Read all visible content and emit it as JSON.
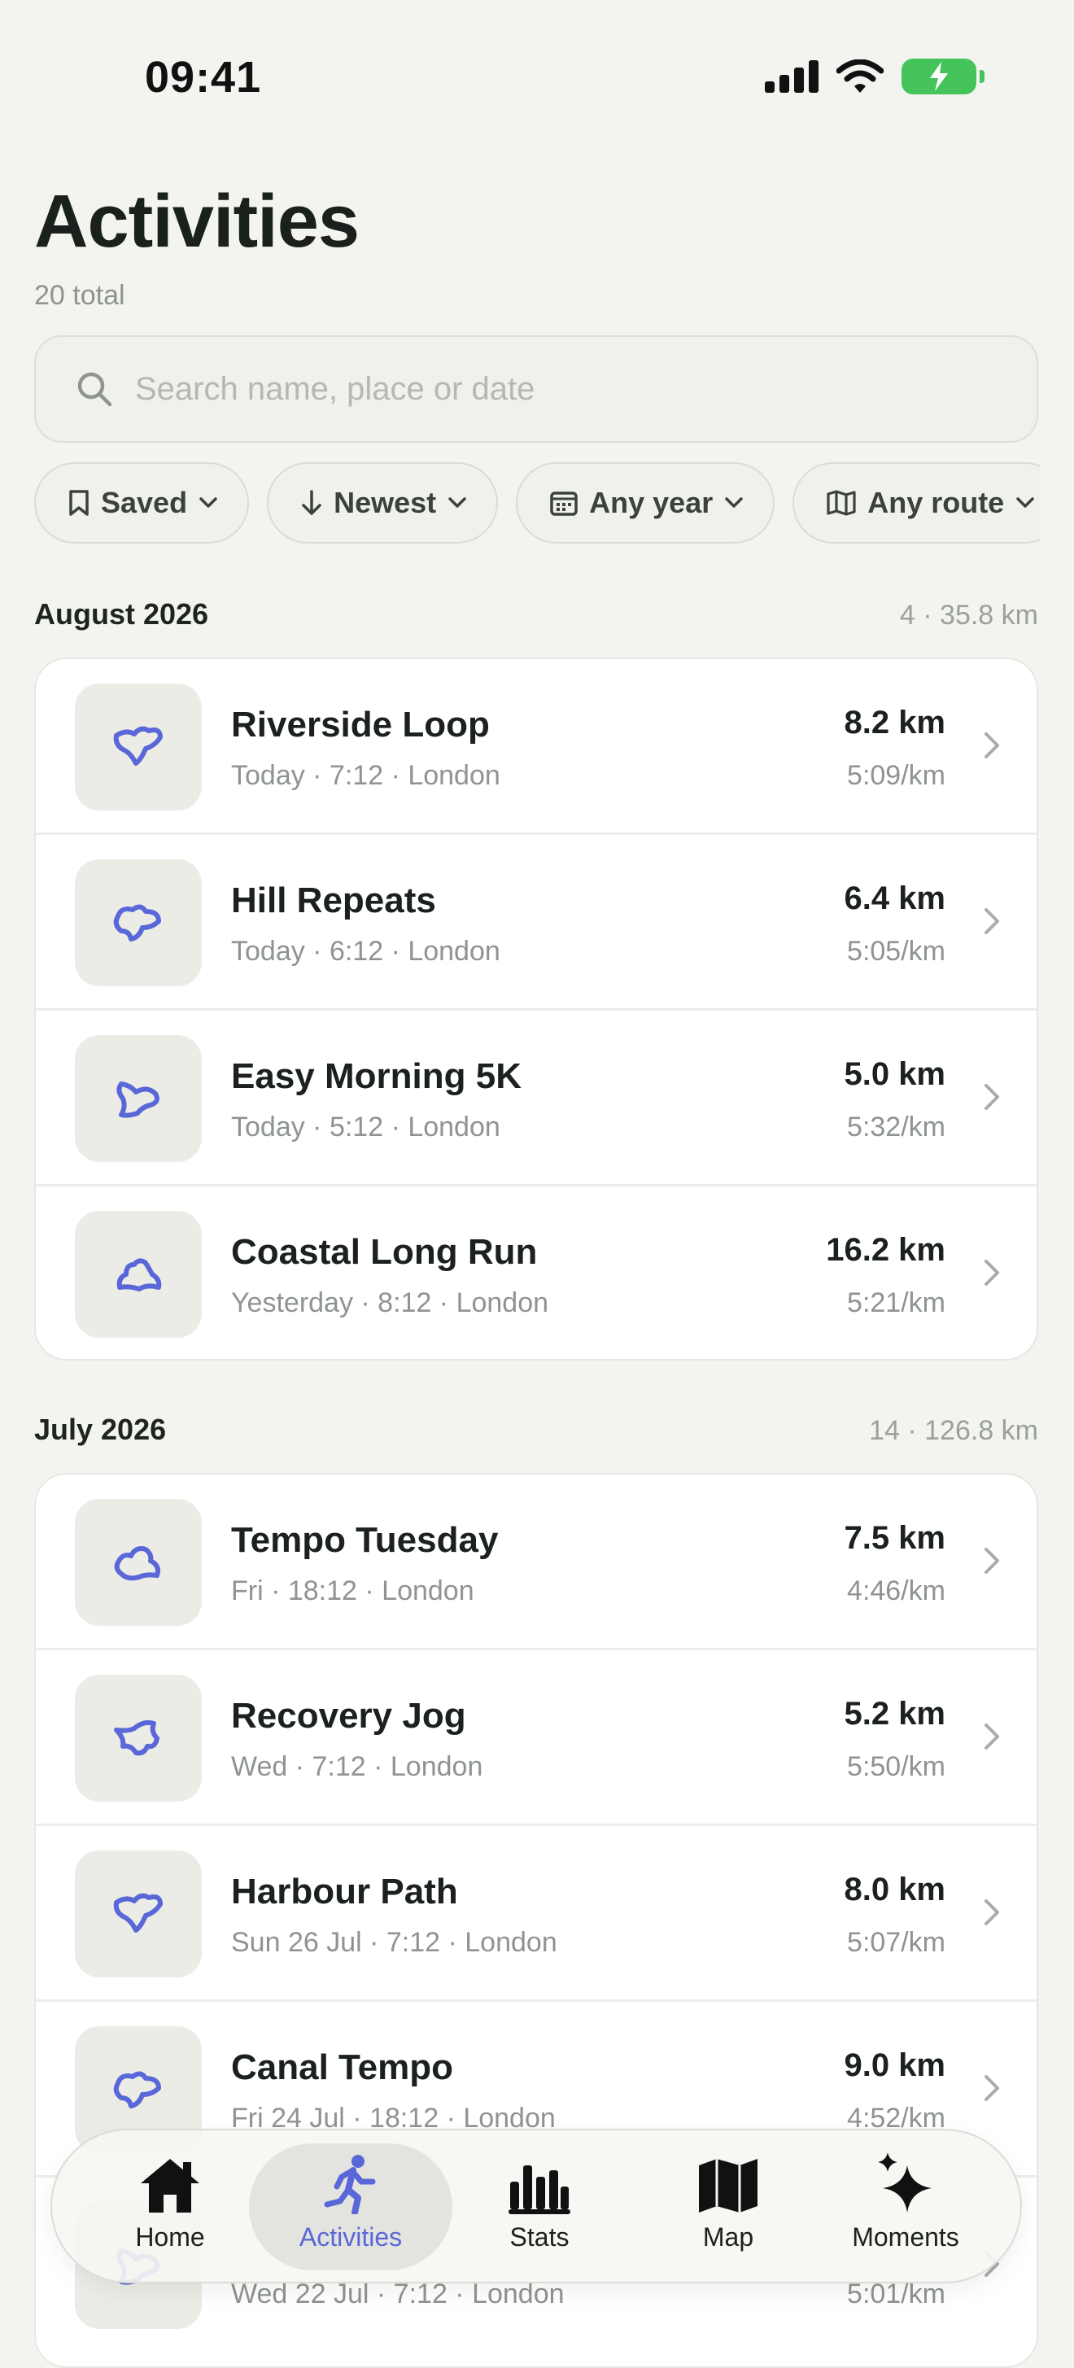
{
  "status": {
    "time": "09:41"
  },
  "header": {
    "title": "Activities",
    "count": "20 total"
  },
  "search": {
    "placeholder": "Search name, place or date",
    "value": ""
  },
  "filters": [
    {
      "label": "Saved",
      "icon": "bookmark-icon"
    },
    {
      "label": "Newest",
      "icon": "arrow-down-icon"
    },
    {
      "label": "Any year",
      "icon": "calendar-icon"
    },
    {
      "label": "Any route",
      "icon": "map-icon"
    }
  ],
  "sections": [
    {
      "title": "August 2026",
      "meta": "4 · 35.8 km",
      "items": [
        {
          "name": "Riverside Loop",
          "sub": "Today · 7:12 · London",
          "distance": "8.2 km",
          "pace": "5:09/km"
        },
        {
          "name": "Hill Repeats",
          "sub": "Today · 6:12 · London",
          "distance": "6.4 km",
          "pace": "5:05/km"
        },
        {
          "name": "Easy Morning 5K",
          "sub": "Today · 5:12 · London",
          "distance": "5.0 km",
          "pace": "5:32/km"
        },
        {
          "name": "Coastal Long Run",
          "sub": "Yesterday · 8:12 · London",
          "distance": "16.2 km",
          "pace": "5:21/km"
        }
      ]
    },
    {
      "title": "July 2026",
      "meta": "14 · 126.8 km",
      "items": [
        {
          "name": "Tempo Tuesday",
          "sub": "Fri · 18:12 · London",
          "distance": "7.5 km",
          "pace": "4:46/km"
        },
        {
          "name": "Recovery Jog",
          "sub": "Wed · 7:12 · London",
          "distance": "5.2 km",
          "pace": "5:50/km"
        },
        {
          "name": "Harbour Path",
          "sub": "Sun 26 Jul · 7:12 · London",
          "distance": "8.0 km",
          "pace": "5:07/km"
        },
        {
          "name": "Canal Tempo",
          "sub": "Fri 24 Jul · 18:12 · London",
          "distance": "9.0 km",
          "pace": "4:52/km"
        },
        {
          "name": "",
          "sub": "Wed 22 Jul · 7:12 · London",
          "distance": "",
          "pace": "5:01/km"
        }
      ]
    }
  ],
  "tabs": [
    {
      "label": "Home",
      "icon": "home-icon",
      "active": false
    },
    {
      "label": "Activities",
      "icon": "runner-icon",
      "active": true
    },
    {
      "label": "Stats",
      "icon": "bar-chart-icon",
      "active": false
    },
    {
      "label": "Map",
      "icon": "map-icon",
      "active": false
    },
    {
      "label": "Moments",
      "icon": "sparkle-icon",
      "active": false
    }
  ],
  "colors": {
    "accent": "#5a67d8",
    "background": "#f3f4f0",
    "battery": "#45c45c"
  }
}
